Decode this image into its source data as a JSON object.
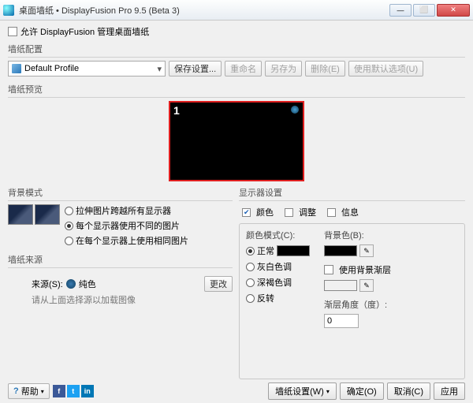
{
  "window": {
    "title": "桌面墙纸 • DisplayFusion Pro 9.5 (Beta 3)"
  },
  "allow_label": "允许 DisplayFusion 管理桌面墙纸",
  "sections": {
    "profile": "墙纸配置",
    "preview": "墙纸预览",
    "bg_mode": "背景模式",
    "source": "墙纸来源",
    "monitor": "显示器设置"
  },
  "profile": {
    "selected": "Default Profile",
    "buttons": {
      "save": "保存设置...",
      "rename": "重命名",
      "saveas": "另存为",
      "delete": "删除(E)",
      "use_default": "使用默认选项(U)"
    }
  },
  "preview": {
    "monitor_number": "1"
  },
  "bg_mode": {
    "opt1": "拉伸图片跨越所有显示器",
    "opt2": "每个显示器使用不同的图片",
    "opt3": "在每个显示器上使用相同图片"
  },
  "source": {
    "label": "来源(S):",
    "value": "纯色",
    "change": "更改",
    "hint": "请从上面选择源以加载图像"
  },
  "tabs": {
    "color": "颜色",
    "adjust": "调整",
    "info": "信息"
  },
  "color_panel": {
    "mode_label": "颜色模式(C):",
    "modes": {
      "normal": "正常",
      "gray": "灰白色调",
      "sepia": "深褐色调",
      "invert": "反转"
    },
    "bg_color_label": "背景色(B):",
    "use_bg_layer": "使用背景渐层",
    "angle_label": "渐层角度（度）:",
    "angle_value": "0"
  },
  "footer": {
    "help": "帮助",
    "wallpaper_settings": "墙纸设置(W)",
    "ok": "确定(O)",
    "cancel": "取消(C)",
    "apply": "应用"
  }
}
